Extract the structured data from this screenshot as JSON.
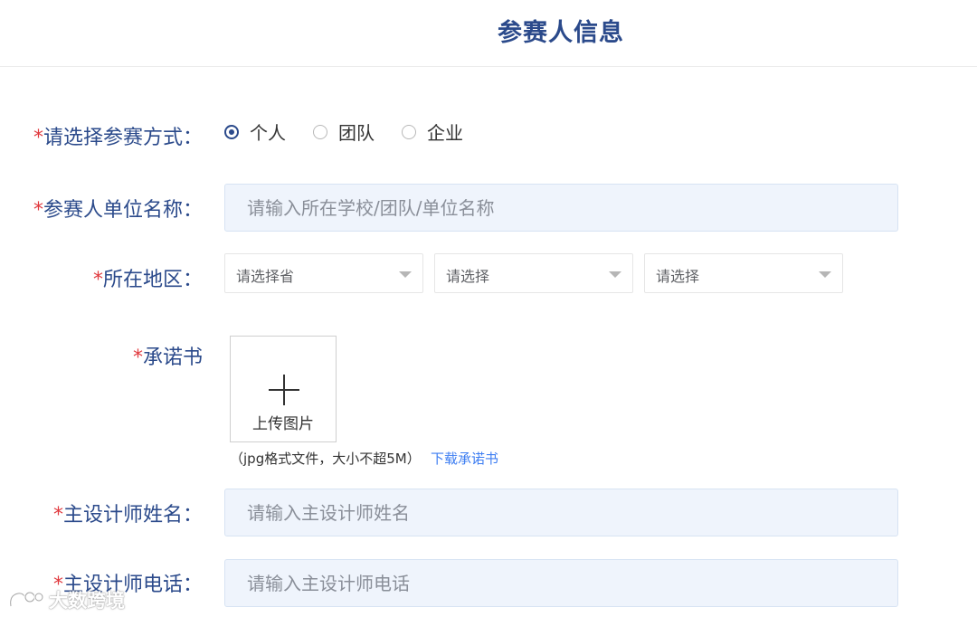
{
  "header": {
    "title": "参赛人信息"
  },
  "form": {
    "participation_type": {
      "label": "请选择参赛方式：",
      "required_mark": "*",
      "options": [
        {
          "label": "个人",
          "checked": true
        },
        {
          "label": "团队",
          "checked": false
        },
        {
          "label": "企业",
          "checked": false
        }
      ]
    },
    "org_name": {
      "label": "参赛人单位名称：",
      "required_mark": "*",
      "value": "",
      "placeholder": "请输入所在学校/团队/单位名称"
    },
    "region": {
      "label": "所在地区：",
      "required_mark": "*",
      "selects": [
        {
          "value": "请选择省"
        },
        {
          "value": "请选择"
        },
        {
          "value": "请选择"
        }
      ]
    },
    "pledge": {
      "label": "承诺书",
      "required_mark": "*",
      "upload_label": "上传图片",
      "hint": "（jpg格式文件，大小不超5M）",
      "download_link": "下载承诺书"
    },
    "designer_name": {
      "label": "主设计师姓名：",
      "required_mark": "*",
      "value": "",
      "placeholder": "请输入主设计师姓名"
    },
    "designer_phone": {
      "label": "主设计师电话：",
      "required_mark": "*",
      "value": "",
      "placeholder": "请输入主设计师电话"
    }
  },
  "watermark": {
    "text": "大数跨境"
  },
  "colors": {
    "label_text": "#2b4a8b",
    "required_mark": "#e0393e",
    "input_bg": "#eff4fc",
    "link": "#3e7ef2"
  }
}
